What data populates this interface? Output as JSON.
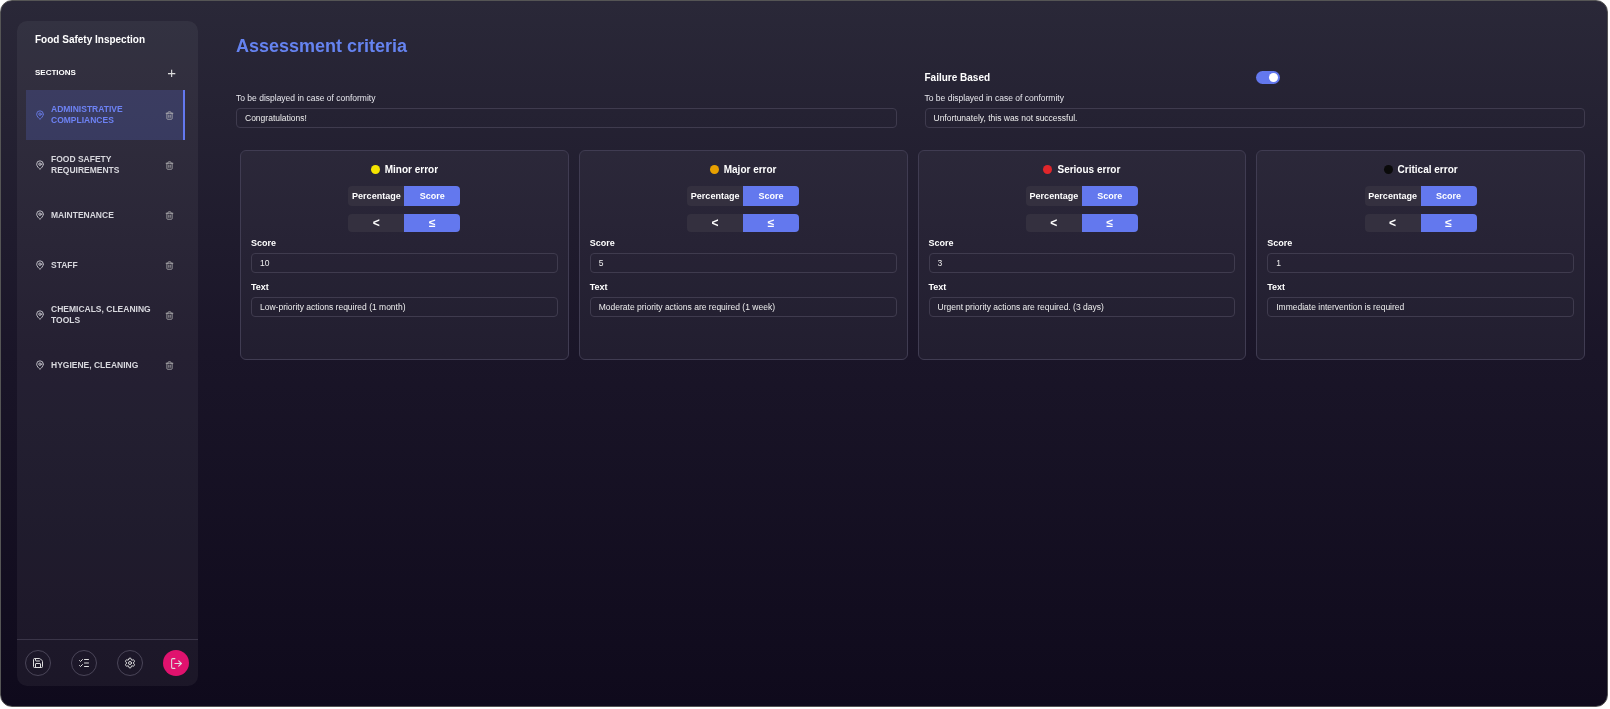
{
  "sidebar": {
    "title": "Food Safety Inspection",
    "sections_label": "SECTIONS",
    "add_icon": "+",
    "items": [
      {
        "label": "ADMINISTRATIVE COMPLIANCES",
        "selected": true
      },
      {
        "label": "FOOD SAFETY REQUIREMENTS",
        "selected": false
      },
      {
        "label": "MAINTENANCE",
        "selected": false
      },
      {
        "label": "STAFF",
        "selected": false
      },
      {
        "label": "CHEMICALS, CLEANING TOOLS",
        "selected": false
      },
      {
        "label": "HYGIENE, CLEANING",
        "selected": false
      }
    ],
    "footer_buttons": [
      {
        "kind": "save"
      },
      {
        "kind": "checklist"
      },
      {
        "kind": "settings"
      },
      {
        "kind": "logout"
      }
    ]
  },
  "main": {
    "title": "Assessment criteria",
    "failure_based": {
      "label": "Failure Based",
      "on": true
    },
    "conformity_fields": [
      {
        "label": "To be displayed in case of conformity",
        "value": "Congratulations!"
      },
      {
        "label": "To be displayed in case of conformity",
        "value": "Unfortunately, this was not successful."
      }
    ],
    "criteria": [
      {
        "title": "Minor error",
        "color": "#f5e400",
        "modes": [
          {
            "label": "Percentage",
            "selected": false
          },
          {
            "label": "Score",
            "selected": true
          }
        ],
        "operators": [
          {
            "label": "<",
            "selected": false
          },
          {
            "label": "≤",
            "selected": true
          }
        ],
        "score_label": "Score",
        "score": "10",
        "text_label": "Text",
        "text": "Low-priority actions required (1 month)"
      },
      {
        "title": "Major error",
        "color": "#e8a000",
        "modes": [
          {
            "label": "Percentage",
            "selected": false
          },
          {
            "label": "Score",
            "selected": true
          }
        ],
        "operators": [
          {
            "label": "<",
            "selected": false
          },
          {
            "label": "≤",
            "selected": true
          }
        ],
        "score_label": "Score",
        "score": "5",
        "text_label": "Text",
        "text": "Moderate priority actions are required (1 week)"
      },
      {
        "title": "Serious error",
        "color": "#e0262b",
        "modes": [
          {
            "label": "Percentage",
            "selected": false
          },
          {
            "label": "Score",
            "selected": true
          }
        ],
        "operators": [
          {
            "label": "<",
            "selected": false
          },
          {
            "label": "≤",
            "selected": true
          }
        ],
        "score_label": "Score",
        "score": "3",
        "text_label": "Text",
        "text": "Urgent priority actions are required. (3 days)"
      },
      {
        "title": "Critical error",
        "color": "#0a0a0a",
        "modes": [
          {
            "label": "Percentage",
            "selected": false
          },
          {
            "label": "Score",
            "selected": true
          }
        ],
        "operators": [
          {
            "label": "<",
            "selected": false
          },
          {
            "label": "≤",
            "selected": true
          }
        ],
        "score_label": "Score",
        "score": "1",
        "text_label": "Text",
        "text": "Immediate intervention is required"
      }
    ]
  }
}
